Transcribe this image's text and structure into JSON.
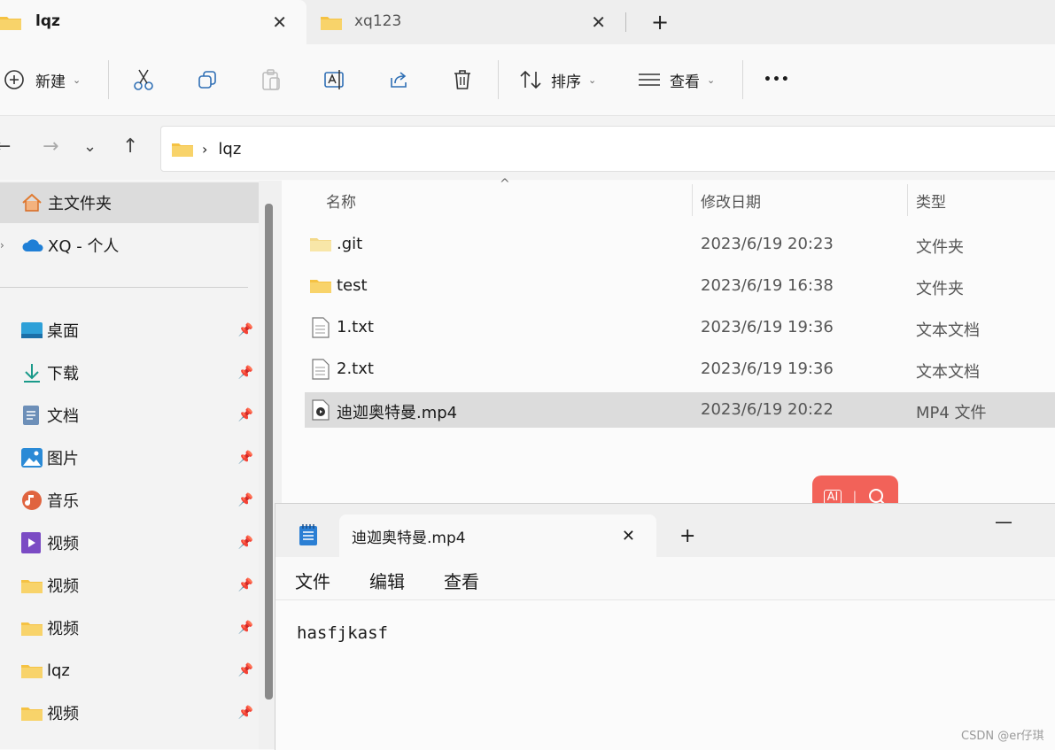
{
  "tabs": [
    {
      "label": "lqz"
    },
    {
      "label": "xq123"
    }
  ],
  "toolbar": {
    "new_label": "新建",
    "sort_label": "排序",
    "view_label": "查看",
    "more_label": "•••"
  },
  "address": {
    "path": "lqz"
  },
  "sidebar": {
    "home": "主文件夹",
    "cloud": "XQ - 个人",
    "items": [
      {
        "label": "桌面",
        "icon": "desktop-icon"
      },
      {
        "label": "下载",
        "icon": "download-icon"
      },
      {
        "label": "文档",
        "icon": "document-icon"
      },
      {
        "label": "图片",
        "icon": "pictures-icon"
      },
      {
        "label": "音乐",
        "icon": "music-icon"
      },
      {
        "label": "视频",
        "icon": "video-icon"
      },
      {
        "label": "视频",
        "icon": "folder-icon"
      },
      {
        "label": "视频",
        "icon": "folder-icon"
      },
      {
        "label": "lqz",
        "icon": "folder-icon"
      },
      {
        "label": "视频",
        "icon": "folder-icon"
      }
    ]
  },
  "filelist": {
    "columns": {
      "name": "名称",
      "date": "修改日期",
      "type": "类型"
    },
    "rows": [
      {
        "name": ".git",
        "date": "2023/6/19 20:23",
        "type": "文件夹",
        "icon": "folder-icon"
      },
      {
        "name": "test",
        "date": "2023/6/19 16:38",
        "type": "文件夹",
        "icon": "folder-icon"
      },
      {
        "name": "1.txt",
        "date": "2023/6/19 19:36",
        "type": "文本文档",
        "icon": "text-file-icon"
      },
      {
        "name": "2.txt",
        "date": "2023/6/19 19:36",
        "type": "文本文档",
        "icon": "text-file-icon"
      },
      {
        "name": "迪迦奥特曼.mp4",
        "date": "2023/6/19 20:22",
        "type": "MP4 文件",
        "icon": "video-file-icon"
      }
    ]
  },
  "notepad": {
    "tab_title": "迪迦奥特曼.mp4",
    "menu": {
      "file": "文件",
      "edit": "编辑",
      "view": "查看"
    },
    "content": "hasfjkasf"
  },
  "ai_bubble": {
    "label": "AI"
  },
  "watermark": "CSDN @er仔琪",
  "colors": {
    "selected_row": "#dcdcdc",
    "ai_bubble": "#f26259",
    "folder": "#f5c243"
  }
}
